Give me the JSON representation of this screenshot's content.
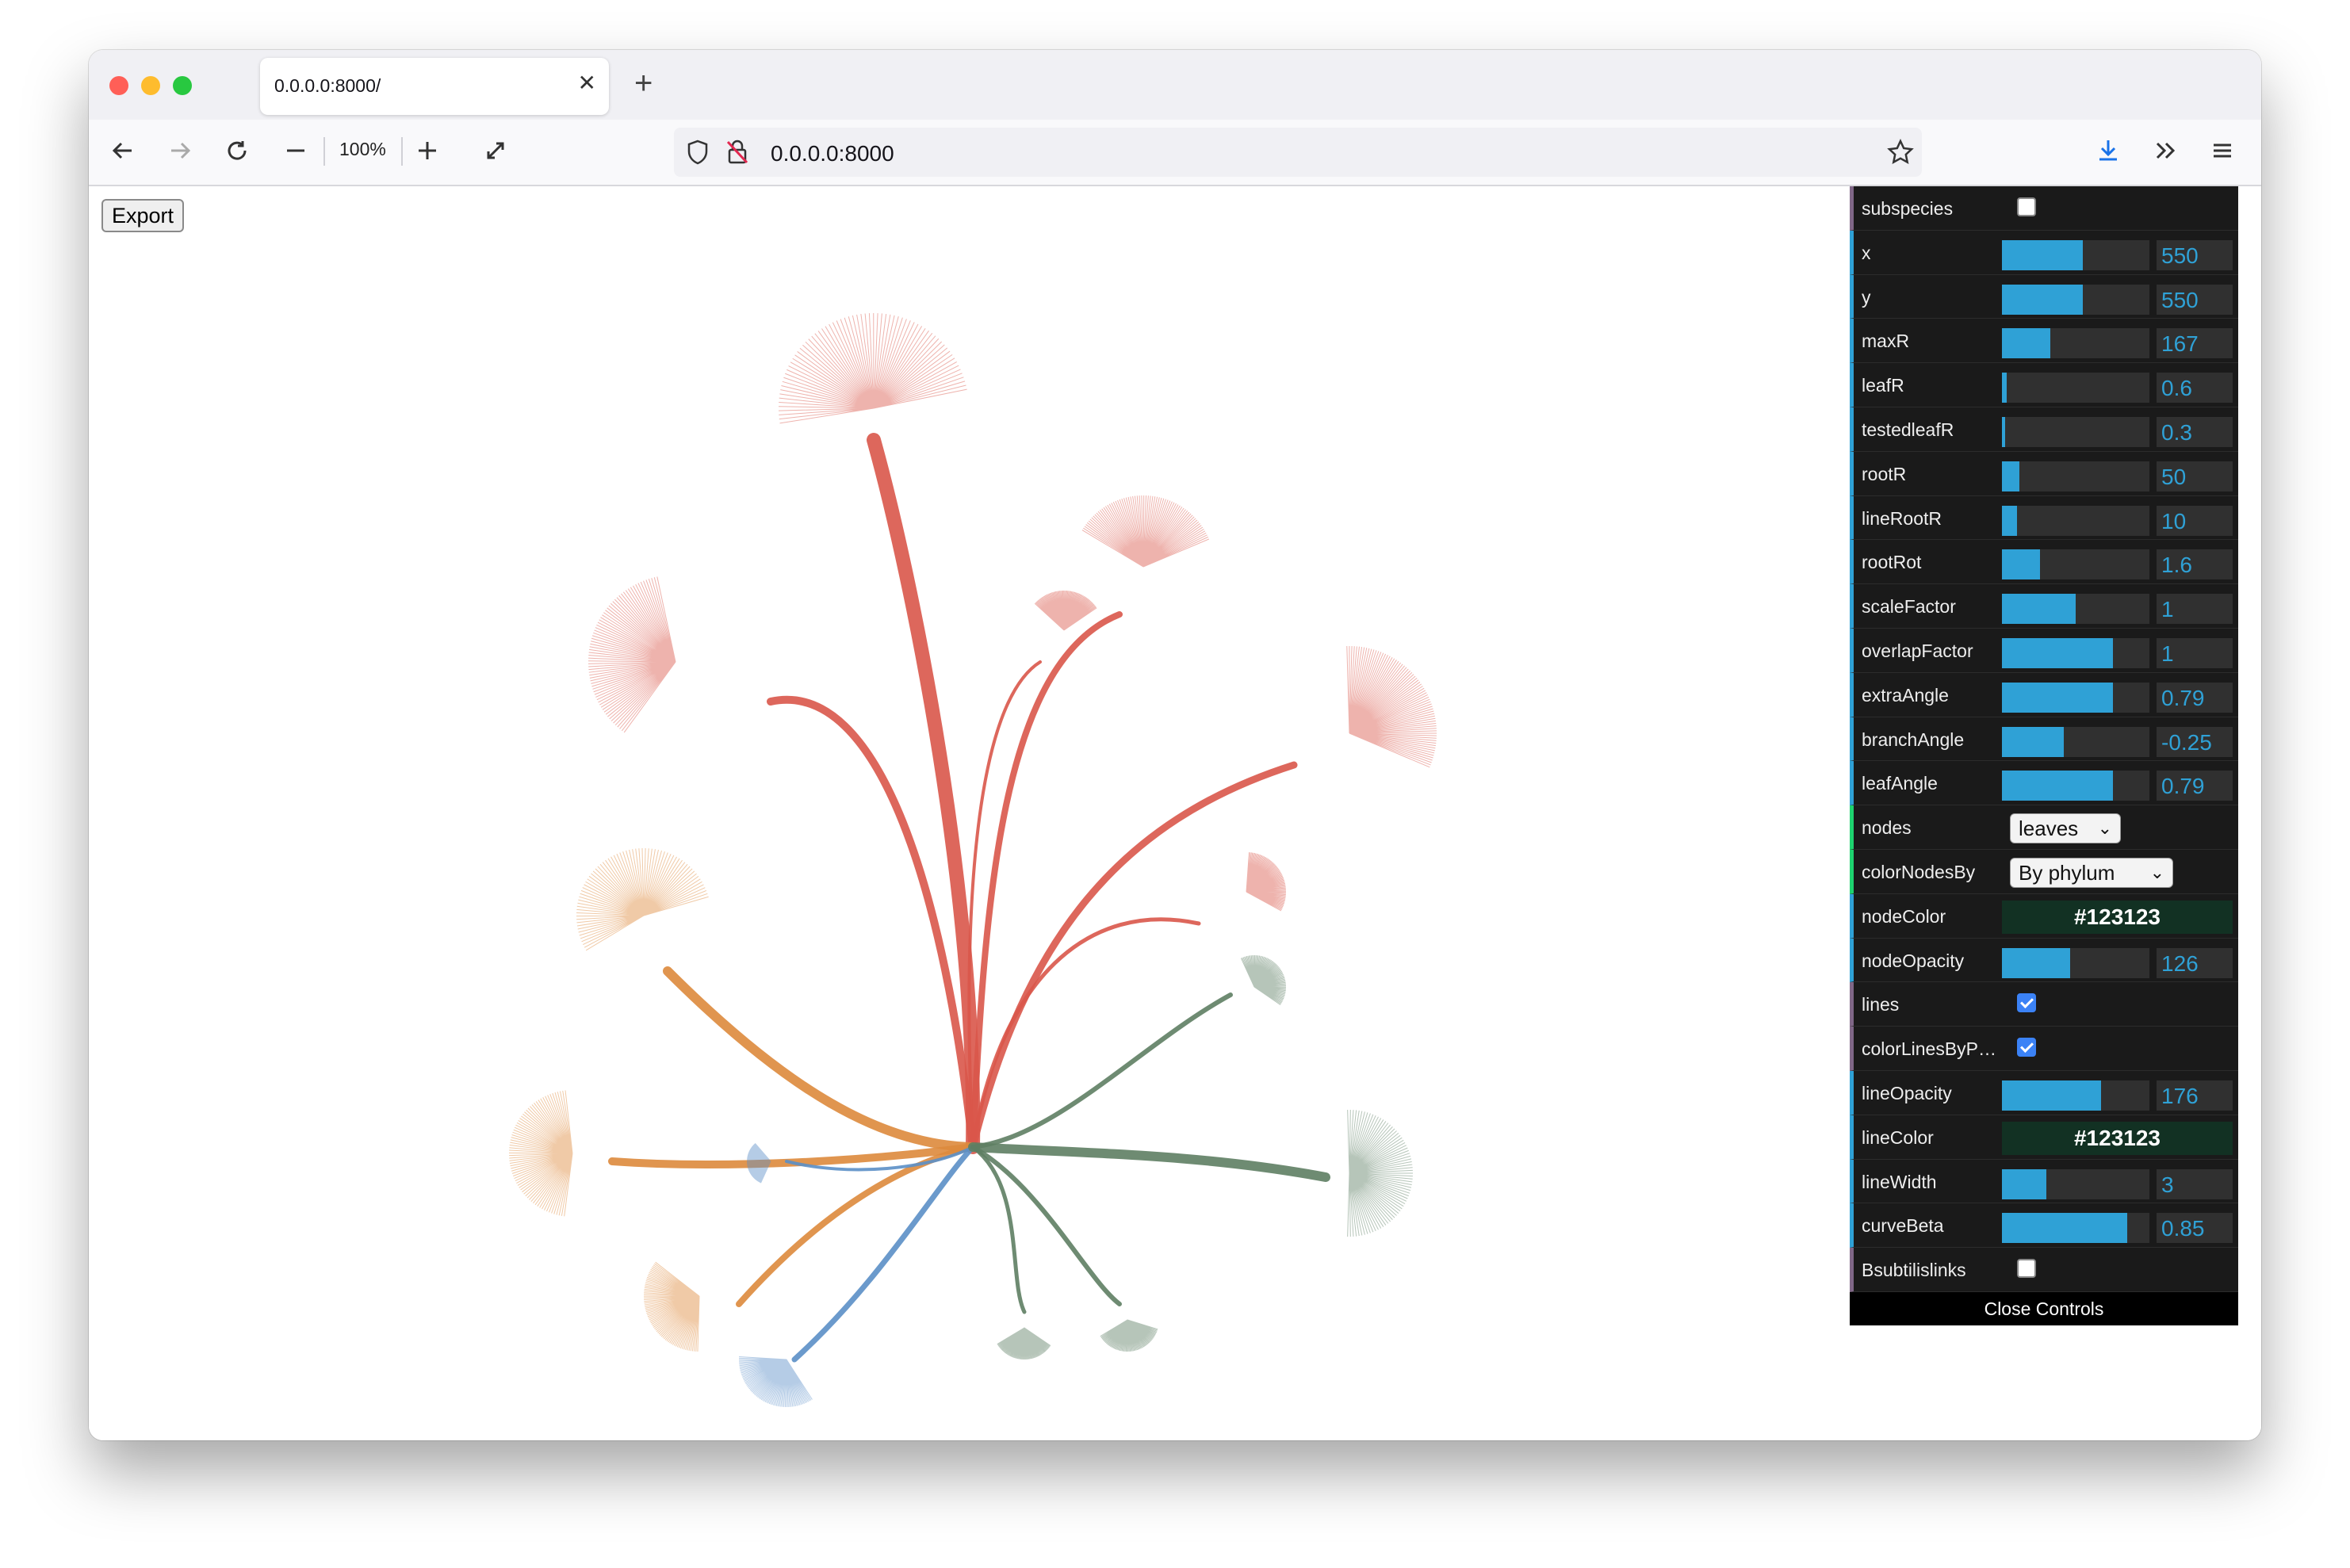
{
  "browser": {
    "tab_title": "0.0.0.0:8000/",
    "zoom_level": "100%",
    "url": "0.0.0.0:8000",
    "icons": [
      "back-icon",
      "forward-icon",
      "reload-icon",
      "zoom-out-icon",
      "zoom-in-icon",
      "fullscreen-icon",
      "shield-icon",
      "insecure-lock-icon",
      "star-icon",
      "download-icon",
      "more-tools-icon",
      "menu-icon"
    ]
  },
  "page": {
    "export_label": "Export"
  },
  "controls": {
    "subspecies": {
      "label": "subspecies",
      "checked": false
    },
    "x": {
      "label": "x",
      "value": "550",
      "fraction": 0.55
    },
    "y": {
      "label": "y",
      "value": "550",
      "fraction": 0.55
    },
    "maxR": {
      "label": "maxR",
      "value": "167",
      "fraction": 0.33
    },
    "leafR": {
      "label": "leafR",
      "value": "0.6",
      "fraction": 0.03
    },
    "testedleafR": {
      "label": "testedleafR",
      "value": "0.3",
      "fraction": 0.02
    },
    "rootR": {
      "label": "rootR",
      "value": "50",
      "fraction": 0.12
    },
    "lineRootR": {
      "label": "lineRootR",
      "value": "10",
      "fraction": 0.1
    },
    "rootRot": {
      "label": "rootRot",
      "value": "1.6",
      "fraction": 0.26
    },
    "scaleFactor": {
      "label": "scaleFactor",
      "value": "1",
      "fraction": 0.5
    },
    "overlapFactor": {
      "label": "overlapFactor",
      "value": "1",
      "fraction": 0.75
    },
    "extraAngle": {
      "label": "extraAngle",
      "value": "0.79",
      "fraction": 0.75
    },
    "branchAngle": {
      "label": "branchAngle",
      "value": "-0.25",
      "fraction": 0.42
    },
    "leafAngle": {
      "label": "leafAngle",
      "value": "0.79",
      "fraction": 0.75
    },
    "nodes": {
      "label": "nodes",
      "selected": "leaves"
    },
    "colorNodesBy": {
      "label": "colorNodesBy",
      "selected": "By phylum"
    },
    "nodeColor": {
      "label": "nodeColor",
      "value": "#123123"
    },
    "nodeOpacity": {
      "label": "nodeOpacity",
      "value": "126",
      "fraction": 0.46
    },
    "lines": {
      "label": "lines",
      "checked": true
    },
    "colorLinesByPhylum": {
      "label": "colorLinesByPh...",
      "checked": true
    },
    "lineOpacity": {
      "label": "lineOpacity",
      "value": "176",
      "fraction": 0.67
    },
    "lineColor": {
      "label": "lineColor",
      "value": "#123123"
    },
    "lineWidth": {
      "label": "lineWidth",
      "value": "3",
      "fraction": 0.3
    },
    "curveBeta": {
      "label": "curveBeta",
      "value": "0.85",
      "fraction": 0.85
    },
    "bsubtilislinks": {
      "label": "Bsubtilislinks",
      "checked": false
    },
    "close_label": "Close Controls"
  },
  "colors": {
    "red": "#d9574a",
    "orange": "#dd8a3c",
    "blue": "#5b8fc7",
    "green": "#5e7e63",
    "accent": "#2fa1d6"
  }
}
